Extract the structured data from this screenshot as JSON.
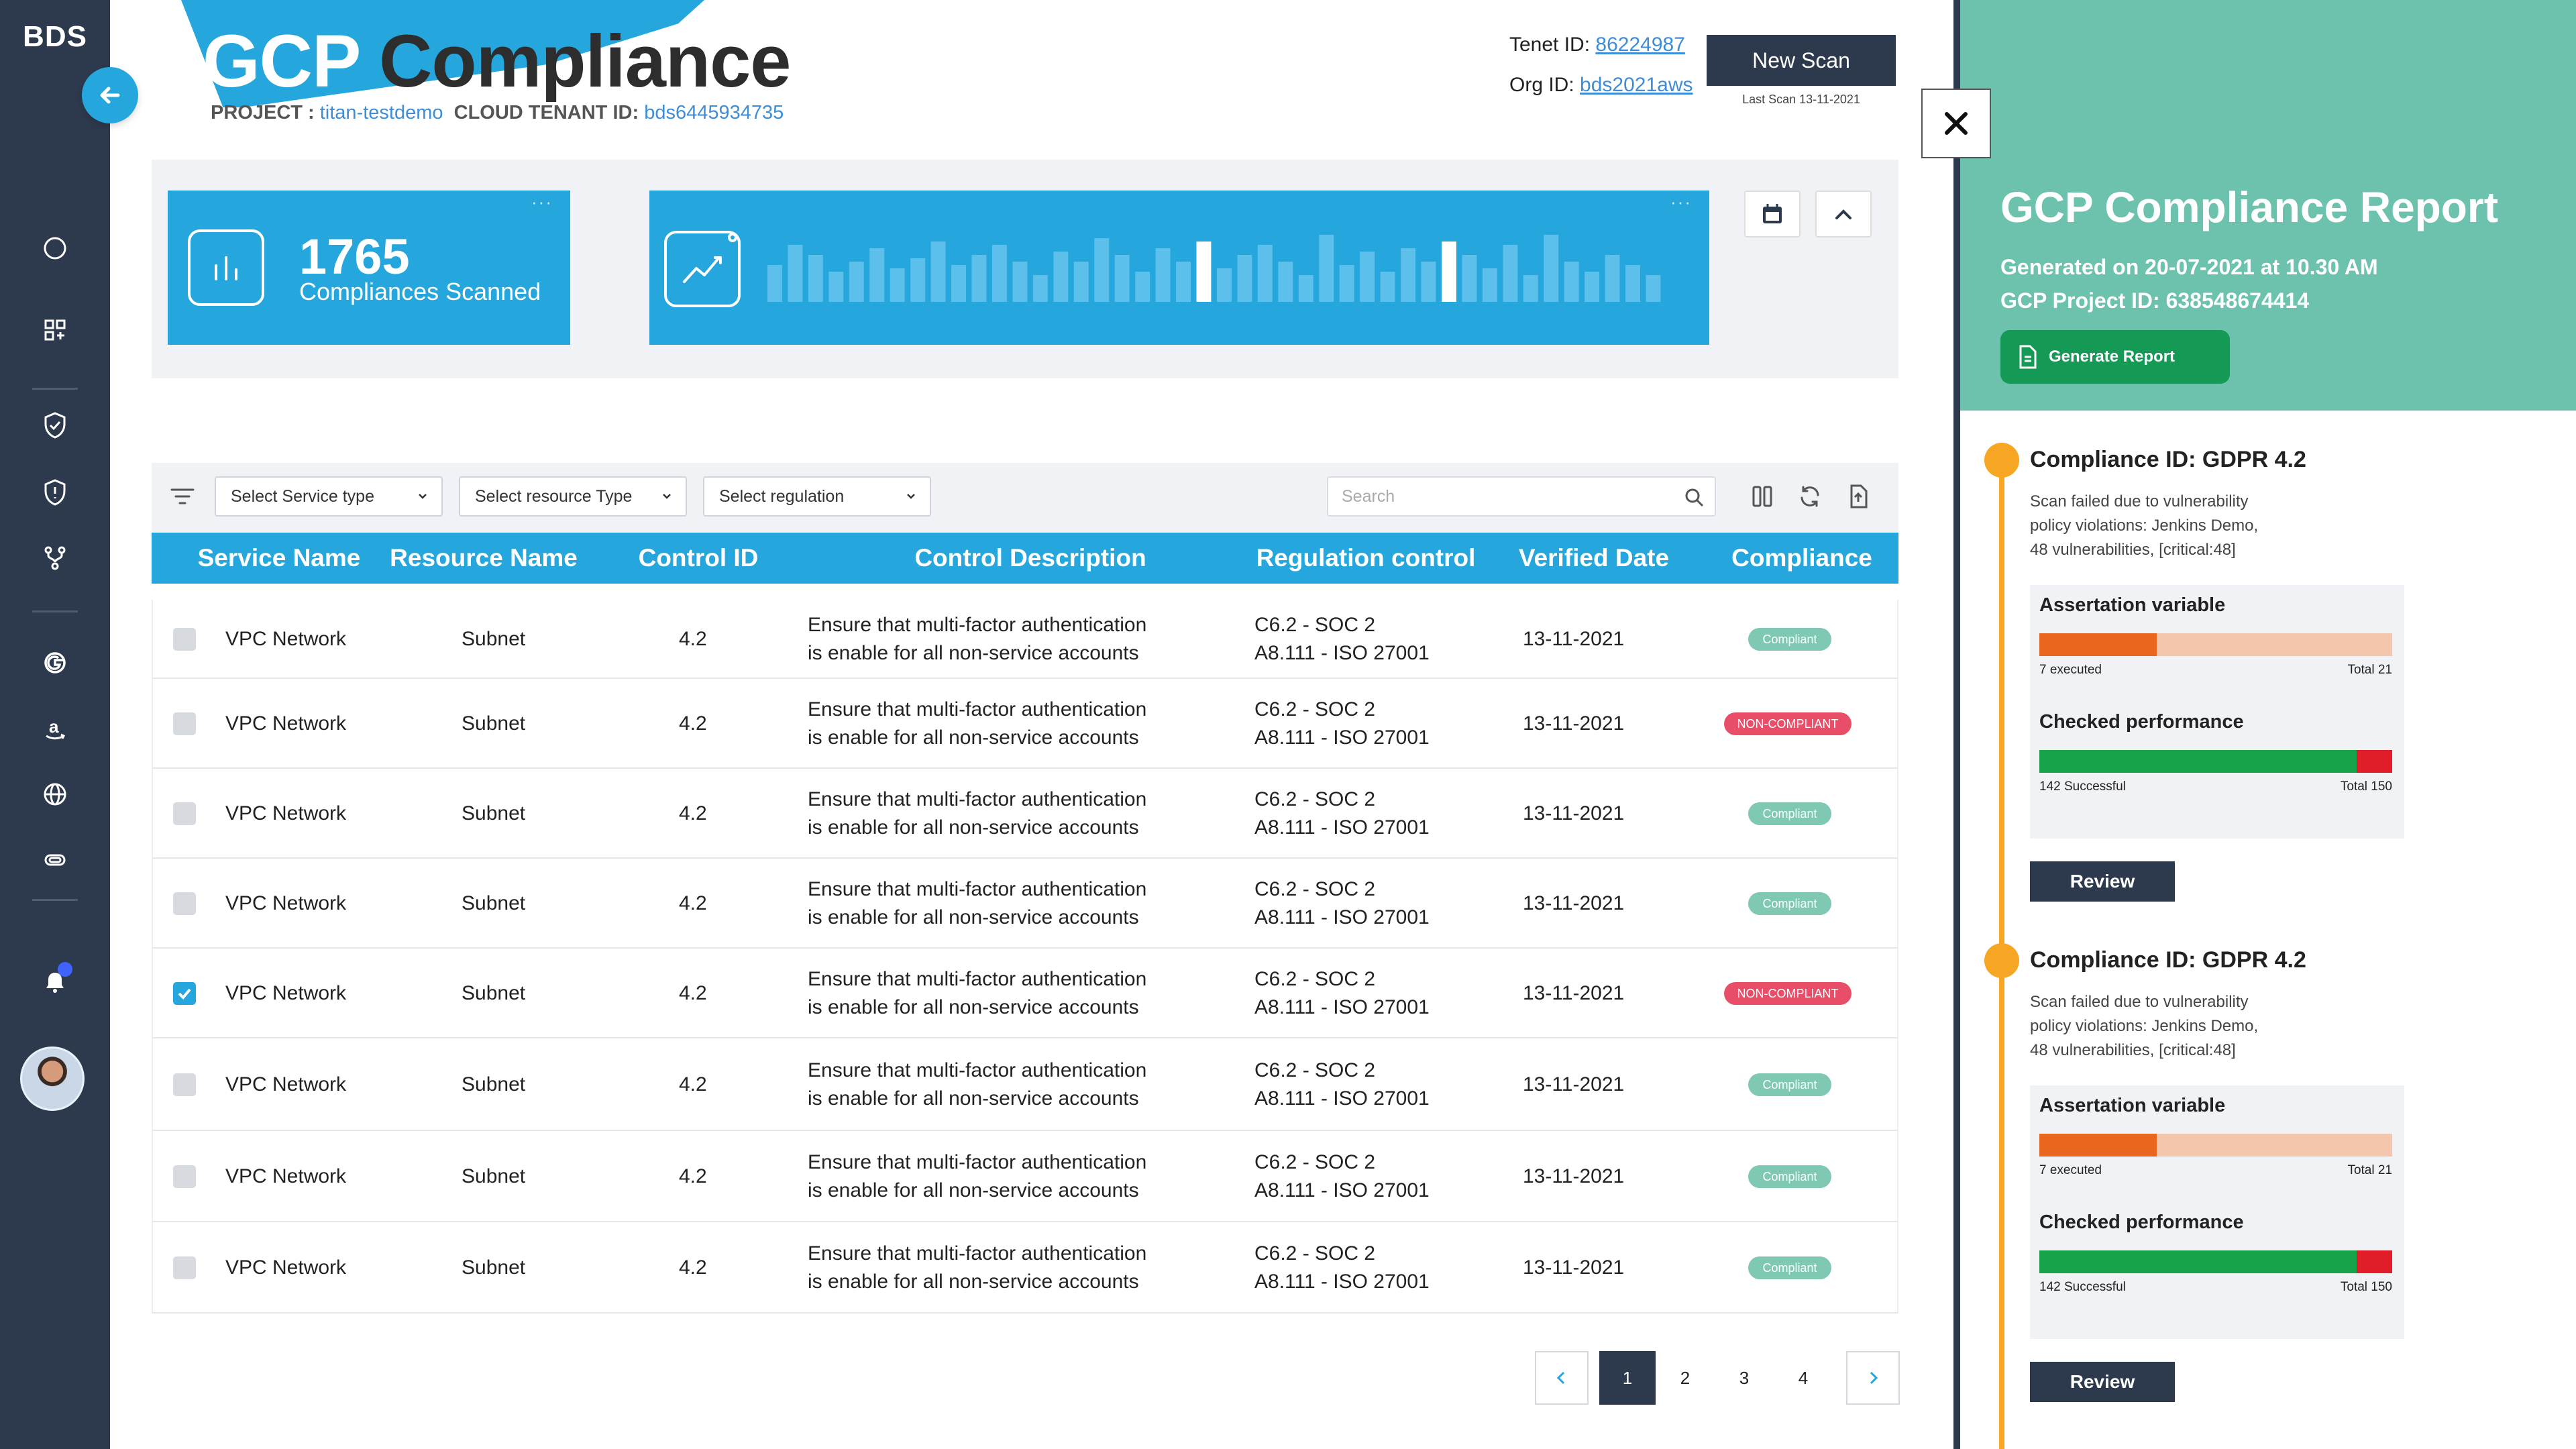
{
  "brand": "BDS",
  "header": {
    "title_part1": "GCP",
    "title_part2": " Compliance",
    "project_label": "PROJECT :",
    "project_value": "titan-testdemo",
    "tenant_label": "CLOUD TENANT ID:",
    "tenant_value": "bds6445934735",
    "tenet_id_label": "Tenet ID:",
    "tenet_id_value": "86224987",
    "org_id_label": "Org ID:",
    "org_id_value": "bds2021aws",
    "new_scan_label": "New Scan",
    "last_scan": "Last Scan 13-11-2021"
  },
  "stats": {
    "count": "1765",
    "label": "Compliances Scanned",
    "bar_levels": [
      0.55,
      0.85,
      0.7,
      0.45,
      0.6,
      0.8,
      0.5,
      0.65,
      0.9,
      0.55,
      0.7,
      0.85,
      0.6,
      0.4,
      0.75,
      0.6,
      0.95,
      0.7,
      0.45,
      0.8,
      0.6,
      0.9,
      0.5,
      0.7,
      0.85,
      0.6,
      0.4,
      1.0,
      0.55,
      0.75,
      0.45,
      0.8,
      0.6,
      0.9,
      0.7,
      0.5,
      0.85,
      0.4,
      1.0,
      0.6,
      0.45,
      0.7,
      0.55,
      0.4
    ],
    "highlight_bars": [
      21,
      33
    ]
  },
  "filters": {
    "service": "Select Service type",
    "resource": "Select resource Type",
    "regulation": "Select regulation",
    "search_placeholder": "Search"
  },
  "table": {
    "headers": [
      "Service Name",
      "Resource Name",
      "Control ID",
      "Control Description",
      "Regulation control",
      "Verified Date",
      "Compliance"
    ],
    "rows": [
      {
        "service": "VPC Network",
        "resource": "Subnet",
        "control": "4.2",
        "desc1": "Ensure that multi-factor authentication",
        "desc2": "is enable for all non-service accounts",
        "reg1": "C6.2 - SOC 2",
        "reg2": "A8.111 - ISO 27001",
        "date": "13-11-2021",
        "status": "Compliant",
        "ok": true,
        "checked": false
      },
      {
        "service": "VPC Network",
        "resource": "Subnet",
        "control": "4.2",
        "desc1": "Ensure that multi-factor authentication",
        "desc2": "is enable for all non-service accounts",
        "reg1": "C6.2 - SOC 2",
        "reg2": "A8.111 - ISO 27001",
        "date": "13-11-2021",
        "status": "NON-COMPLIANT",
        "ok": false,
        "checked": false
      },
      {
        "service": "VPC Network",
        "resource": "Subnet",
        "control": "4.2",
        "desc1": "Ensure that multi-factor authentication",
        "desc2": "is enable for all non-service accounts",
        "reg1": "C6.2 - SOC 2",
        "reg2": "A8.111 - ISO 27001",
        "date": "13-11-2021",
        "status": "Compliant",
        "ok": true,
        "checked": false
      },
      {
        "service": "VPC Network",
        "resource": "Subnet",
        "control": "4.2",
        "desc1": "Ensure that multi-factor authentication",
        "desc2": "is enable for all non-service accounts",
        "reg1": "C6.2 - SOC 2",
        "reg2": "A8.111 - ISO 27001",
        "date": "13-11-2021",
        "status": "Compliant",
        "ok": true,
        "checked": false
      },
      {
        "service": "VPC Network",
        "resource": "Subnet",
        "control": "4.2",
        "desc1": "Ensure that multi-factor authentication",
        "desc2": "is enable for all non-service accounts",
        "reg1": "C6.2 - SOC 2",
        "reg2": "A8.111 - ISO 27001",
        "date": "13-11-2021",
        "status": "NON-COMPLIANT",
        "ok": false,
        "checked": true
      },
      {
        "service": "VPC Network",
        "resource": "Subnet",
        "control": "4.2",
        "desc1": "Ensure that multi-factor authentication",
        "desc2": "is enable for all non-service accounts",
        "reg1": "C6.2 - SOC 2",
        "reg2": "A8.111 - ISO 27001",
        "date": "13-11-2021",
        "status": "Compliant",
        "ok": true,
        "checked": false
      },
      {
        "service": "VPC Network",
        "resource": "Subnet",
        "control": "4.2",
        "desc1": "Ensure that multi-factor authentication",
        "desc2": "is enable for all non-service accounts",
        "reg1": "C6.2 - SOC 2",
        "reg2": "A8.111 - ISO 27001",
        "date": "13-11-2021",
        "status": "Compliant",
        "ok": true,
        "checked": false
      },
      {
        "service": "VPC Network",
        "resource": "Subnet",
        "control": "4.2",
        "desc1": "Ensure that multi-factor authentication",
        "desc2": "is enable for all non-service accounts",
        "reg1": "C6.2 - SOC 2",
        "reg2": "A8.111 - ISO 27001",
        "date": "13-11-2021",
        "status": "Compliant",
        "ok": true,
        "checked": false
      }
    ]
  },
  "pagination": {
    "pages": [
      "1",
      "2",
      "3",
      "4"
    ],
    "active": "1"
  },
  "report": {
    "title": "GCP Compliance Report",
    "generated": "Generated on 20-07-2021 at 10.30 AM",
    "project": "GCP Project ID: 638548674414",
    "generate_btn": "Generate Report",
    "items": [
      {
        "title": "Compliance ID: GDPR 4.2",
        "desc1": "Scan failed due to vulnerability",
        "desc2": "policy violations: Jenkins Demo,",
        "desc3": "48 vulnerabilities, [critical:48]",
        "assert_title": "Assertation variable",
        "assert_left": "7 executed",
        "assert_right": "Total 21",
        "assert_fraction": 0.333,
        "perf_title": "Checked performance",
        "perf_left": "142 Successful",
        "perf_right": "Total 150",
        "perf_fraction": 0.9,
        "review": "Review"
      },
      {
        "title": "Compliance ID: GDPR 4.2",
        "desc1": "Scan failed due to vulnerability",
        "desc2": "policy violations: Jenkins Demo,",
        "desc3": "48 vulnerabilities, [critical:48]",
        "assert_title": "Assertation variable",
        "assert_left": "7 executed",
        "assert_right": "Total 21",
        "assert_fraction": 0.333,
        "perf_title": "Checked performance",
        "perf_left": "142 Successful",
        "perf_right": "Total 150",
        "perf_fraction": 0.9,
        "review": "Review"
      }
    ]
  },
  "colors": {
    "accent": "#25a7de",
    "dark": "#2d3a4e",
    "compliant": "#7fc9b4",
    "non_compliant": "#e94e69",
    "report_bg": "#6cc2ac",
    "timeline": "#f6a623",
    "bar_orange": "#e9661e",
    "bar_orange_light": "#f4c6ad",
    "bar_green": "#16a34a",
    "bar_red": "#e11d2a"
  },
  "icons": [
    "back-arrow-icon",
    "circle-icon",
    "grid-add-icon",
    "shield-check-icon",
    "shield-alert-icon",
    "branch-icon",
    "google-icon",
    "amazon-icon",
    "globe-icon",
    "cloud-icon",
    "bell-icon",
    "bar-chart-icon",
    "trend-chart-icon",
    "calendar-icon",
    "chevron-up-icon",
    "filter-icon",
    "chevron-down-icon",
    "search-icon",
    "columns-icon",
    "refresh-icon",
    "export-icon",
    "close-icon",
    "document-icon",
    "chevron-left-icon",
    "chevron-right-icon"
  ]
}
